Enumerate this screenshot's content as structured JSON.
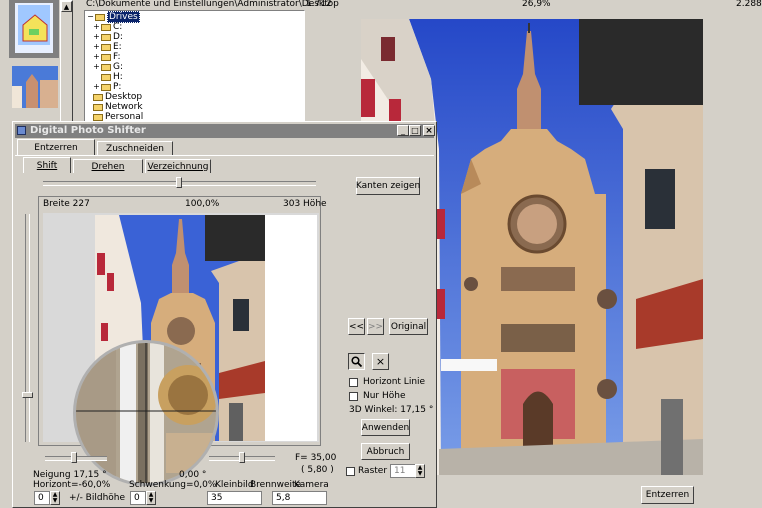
{
  "topbar": {
    "path": "C:\\Dokumente und Einstellungen\\Administrator\\Desktop",
    "value1": "1.712",
    "percent": "26,9%",
    "value2": "2.288"
  },
  "tree": {
    "items": [
      {
        "label": "Drives",
        "expander": "−",
        "selected": true
      },
      {
        "label": "C:",
        "expander": "+"
      },
      {
        "label": "D:",
        "expander": "+"
      },
      {
        "label": "E:",
        "expander": "+"
      },
      {
        "label": "F:",
        "expander": "+"
      },
      {
        "label": "G:",
        "expander": "+"
      },
      {
        "label": "H:",
        "expander": ""
      },
      {
        "label": "P:",
        "expander": "+"
      },
      {
        "label": "Desktop",
        "expander": ""
      },
      {
        "label": "Network",
        "expander": ""
      },
      {
        "label": "Personal",
        "expander": ""
      }
    ]
  },
  "dialog": {
    "title": "Digital Photo Shifter",
    "tabs_top": [
      "Entzerren",
      "Zuschneiden"
    ],
    "tabs_sub": [
      "Shift",
      "Drehen",
      "Verzeichnung"
    ],
    "preview_info": {
      "width": "Breite 227",
      "zoom": "100,0%",
      "height": "303 Höhe"
    },
    "buttons": {
      "kanten": "Kanten zeigen",
      "prev": "<<",
      "next": ">>",
      "original": "Original",
      "anwenden": "Anwenden",
      "abbruch": "Abbruch"
    },
    "checkboxes": {
      "horizont": "Horizont Linie",
      "nur_hoehe": "Nur Höhe",
      "raster": "Raster"
    },
    "angle3d": "3D Winkel: 17,15 °",
    "raster_value": "11",
    "neigung": "Neigung 17,15 °",
    "horizont": "Horizont=-60,0%",
    "schwenk": "Schwenkung=0,0%",
    "schwenk_deg": "0,00 °",
    "focal": {
      "f": "F= 35,00",
      "f2": "( 5,80 )"
    },
    "bottom_labels": {
      "bildhoehe": "+/- Bildhöhe",
      "kleinbild": "Kleinbild",
      "brennweite": "Brennweite",
      "kamera": "Kamera"
    },
    "fields": {
      "bild": "0",
      "schwenk": "0",
      "kleinbild": "35",
      "kamera": "5,8"
    }
  },
  "main_button": "Entzerren",
  "colors": {
    "titlebar": "#7f7f7f",
    "selection": "#0a246a",
    "sky": "#3c5fd8"
  }
}
